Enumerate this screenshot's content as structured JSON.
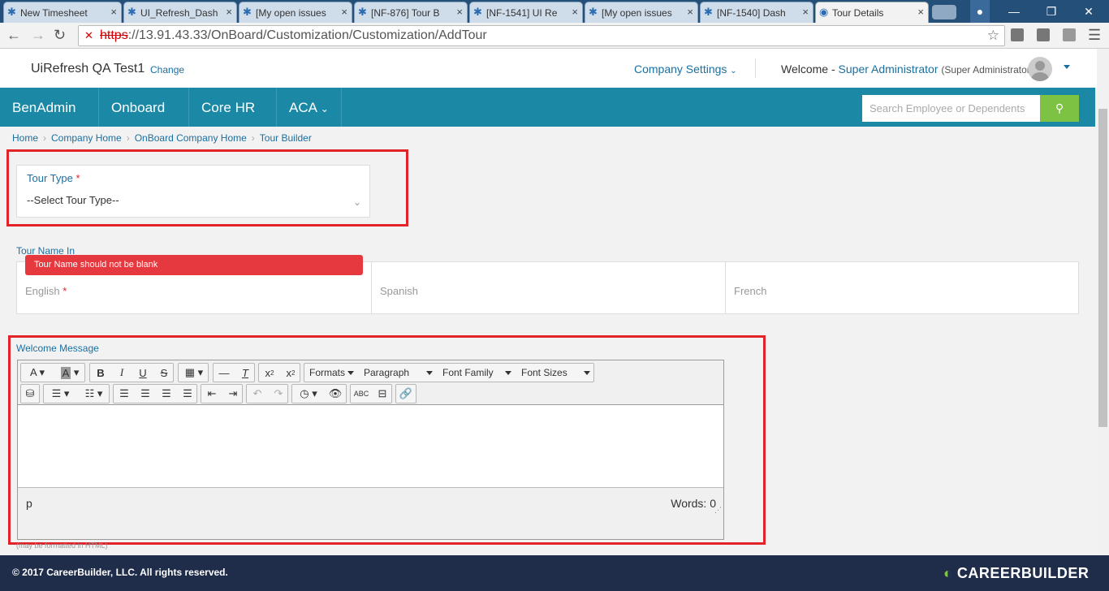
{
  "browser": {
    "tabs": [
      {
        "title": "New Timesheet"
      },
      {
        "title": "UI_Refresh_Dash"
      },
      {
        "title": "[My open issues"
      },
      {
        "title": "[NF-876] Tour B"
      },
      {
        "title": "[NF-1541] UI Re"
      },
      {
        "title": "[My open issues"
      },
      {
        "title": "[NF-1540] Dash"
      },
      {
        "title": "Tour Details"
      }
    ],
    "url_scheme": "https",
    "url_rest": "://13.91.43.33/OnBoard/Customization/Customization/AddTour"
  },
  "header": {
    "company": "UiRefresh QA Test1",
    "change": "Change",
    "company_settings": "Company Settings",
    "welcome": "Welcome -",
    "username": "Super Administrator",
    "role": "(Super Administrator)"
  },
  "nav": {
    "items": [
      "BenAdmin",
      "Onboard",
      "Core HR",
      "ACA"
    ],
    "search_placeholder": "Search Employee or Dependents"
  },
  "breadcrumb": [
    "Home",
    "Company Home",
    "OnBoard Company Home",
    "Tour Builder"
  ],
  "form": {
    "tour_type_label": "Tour Type",
    "required_mark": "*",
    "tour_type_value": "--Select Tour Type--",
    "tour_name_label": "Tour Name In",
    "error": "Tour Name should not be blank",
    "languages": [
      "English",
      "Spanish",
      "French"
    ],
    "welcome_label": "Welcome Message",
    "hint": "(may be formatted in HTML)"
  },
  "editor": {
    "formats": "Formats",
    "paragraph": "Paragraph",
    "font_family": "Font Family",
    "font_sizes": "Font Sizes",
    "path": "p",
    "words": "Words: 0"
  },
  "footer": {
    "copyright": "© 2017 CareerBuilder, LLC. All rights reserved.",
    "logo": "CAREERBUILDER"
  },
  "colors": {
    "nav": "#1b88a6",
    "error": "#e6393f",
    "highlight": "#e2232a",
    "search_button": "#7dc242",
    "footer": "#1f2d4a"
  }
}
